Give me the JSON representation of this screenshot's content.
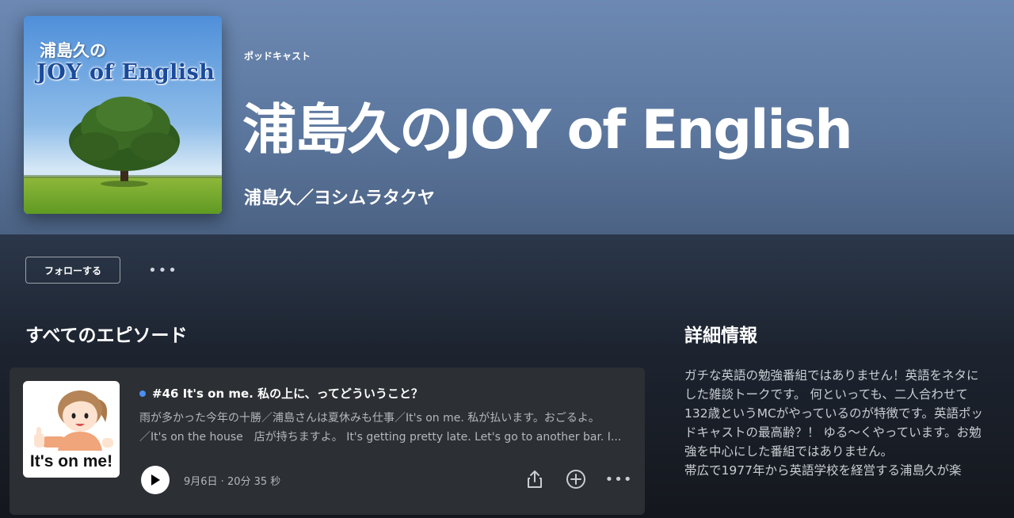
{
  "show": {
    "cover_title_jp": "浦島久の",
    "cover_title_en": "JOY of English",
    "type_label": "ポッドキャスト",
    "title": "浦島久のJOY of English",
    "author": "浦島久／ヨシムラタクヤ"
  },
  "actions": {
    "follow_label": "フォローする",
    "more_label": "•••"
  },
  "episodes_section": {
    "title": "すべてのエピソード",
    "episodes": [
      {
        "thumb_text": "It's on me!",
        "title": "#46 It's on me. 私の上に、ってどういうこと？",
        "desc_line1": "雨が多かった今年の十勝／浦島さんは夏休みも仕事／It's on me. 私が払います。おごるよ。",
        "desc_line2": "／It's on the house　店が持ちますよ。 It's getting pretty late. Let's go to another bar. I...",
        "meta": "9月6日 · 20分 35 秒",
        "more_label": "•••"
      }
    ]
  },
  "details": {
    "title": "詳細情報",
    "paragraph1": "ガチな英語の勉強番組ではありません！英語をネタにした雑談トークです。 何といっても、二人合わせて132歳というMCがやっているのが特徴です。英語ポッドキャストの最高齢？！ ゆる〜くやっています。お勉強を中心にした番組ではありません。",
    "paragraph2": "帯広で1977年から英語学校を経営する浦島久が楽"
  },
  "colors": {
    "header_blue": "#6c89b3",
    "new_dot": "#4d8ef0",
    "card_bg": "#2c2f33"
  },
  "icons": [
    "share-icon",
    "add-circle-icon",
    "play-icon",
    "more-icon"
  ]
}
